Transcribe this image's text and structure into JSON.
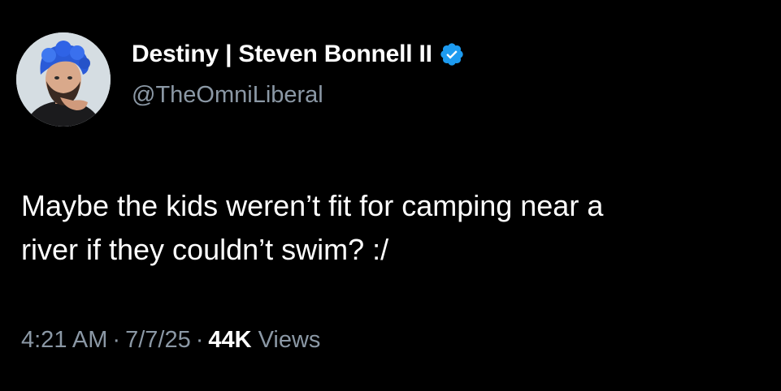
{
  "author": {
    "display_name": "Destiny | Steven Bonnell II",
    "handle": "@TheOmniLiberal",
    "verified": true,
    "verified_icon": "verified-badge-icon",
    "avatar_icon": "profile-photo-blue-hair"
  },
  "tweet": {
    "text_lines": [
      "Maybe the kids weren’t fit for camping near a",
      "river if they couldn’t swim? :/"
    ]
  },
  "meta": {
    "time": "4:21 AM",
    "separator": "·",
    "date": "7/7/25",
    "views_count": "44K",
    "views_label": "Views"
  },
  "colors": {
    "background": "#000000",
    "primary_text": "#ffffff",
    "secondary_text": "#8b98a5",
    "verified_blue": "#1d9bf0"
  }
}
